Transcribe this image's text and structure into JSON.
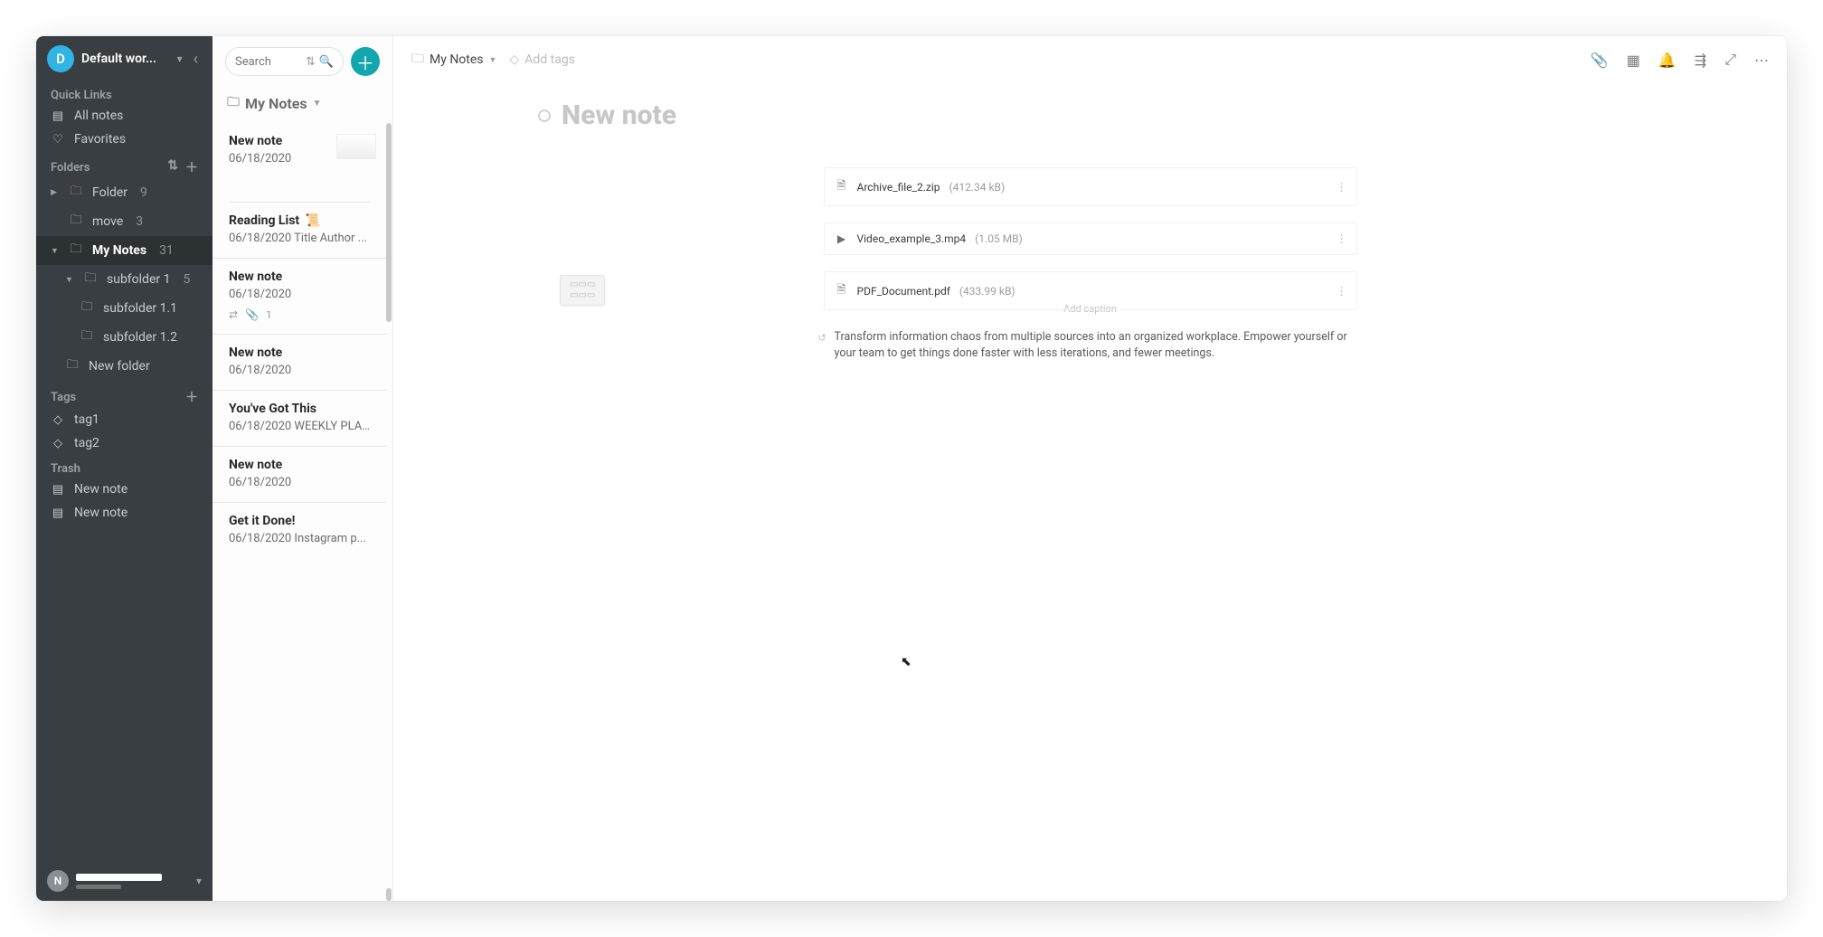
{
  "workspace": {
    "avatar_letter": "D",
    "name": "Default wor..."
  },
  "sidebar": {
    "quick_links_label": "Quick Links",
    "all_notes": "All notes",
    "favorites": "Favorites",
    "folders_label": "Folders",
    "folders": [
      {
        "name": "Folder",
        "count": "9"
      },
      {
        "name": "move",
        "count": "3"
      },
      {
        "name": "My Notes",
        "count": "31",
        "active": true,
        "children": [
          {
            "name": "subfolder 1",
            "count": "5",
            "children": [
              {
                "name": "subfolder 1.1"
              },
              {
                "name": "subfolder 1.2"
              }
            ]
          },
          {
            "name": "New folder"
          }
        ]
      }
    ],
    "tags_label": "Tags",
    "tags": [
      {
        "name": "tag1"
      },
      {
        "name": "tag2"
      }
    ],
    "trash_label": "Trash",
    "trash": [
      {
        "name": "New note"
      },
      {
        "name": "New note"
      }
    ],
    "bottom_avatar": "N"
  },
  "notelist": {
    "search_placeholder": "Search",
    "crumb": "My Notes",
    "items": [
      {
        "title": "New note",
        "date": "06/18/2020",
        "has_thumb": true
      },
      {
        "title": "Reading List",
        "emoji": "📜",
        "date": "06/18/2020",
        "snippet": "Title Author ..."
      },
      {
        "title": "New note",
        "date": "06/18/2020",
        "attachments": "1",
        "shared": true
      },
      {
        "title": "New note",
        "date": "06/18/2020"
      },
      {
        "title": "You've Got This",
        "date": "06/18/2020",
        "snippet": "WEEKLY PLA..."
      },
      {
        "title": "New note",
        "date": "06/18/2020"
      },
      {
        "title": "Get it Done!",
        "date": "06/18/2020",
        "snippet": "Instagram p..."
      }
    ]
  },
  "editor": {
    "crumb": "My Notes",
    "add_tags": "Add tags",
    "title": "New note",
    "attachments": [
      {
        "icon": "file",
        "name": "Archive_file_2.zip",
        "size": "(412.34 kB)"
      },
      {
        "icon": "video",
        "name": "Video_example_3.mp4",
        "size": "(1.05 MB)"
      },
      {
        "icon": "file",
        "name": "PDF_Document.pdf",
        "size": "(433.99 kB)"
      }
    ],
    "caption": "Add caption",
    "paragraph": "Transform information chaos from multiple sources into an organized workplace. Empower yourself or your team to get things done faster with less iterations, and fewer meetings."
  }
}
